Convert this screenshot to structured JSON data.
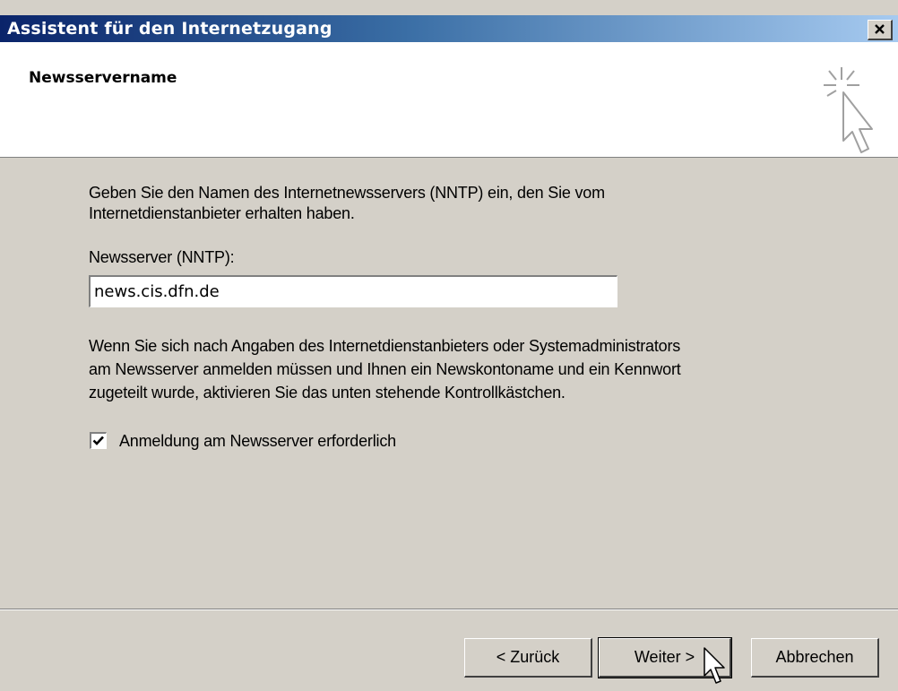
{
  "window": {
    "title": "Assistent für den Internetzugang",
    "close_icon": "close-icon"
  },
  "header": {
    "title": "Newsservername",
    "icon": "wizard-sparkle-cursor-icon"
  },
  "content": {
    "intro_line1": "Geben Sie den Namen des Internetnewsservers (NNTP) ein, den Sie vom",
    "intro_line2": "Internetdienstanbieter erhalten haben.",
    "server_label": "Newsserver (NNTP):",
    "server_value": "news.cis.dfn.de",
    "info_line1": "Wenn Sie sich nach Angaben des Internetdienstanbieters oder Systemadministrators",
    "info_line2": "am Newsserver anmelden müssen und Ihnen ein Newskontoname und ein Kennwort",
    "info_line3": "zugeteilt wurde, aktivieren Sie das unten stehende Kontrollkästchen.",
    "checkbox_label": "Anmeldung am Newsserver erforderlich",
    "checkbox_checked": true
  },
  "buttons": {
    "back": "< Zurück",
    "next": "Weiter >",
    "cancel": "Abbrechen"
  }
}
